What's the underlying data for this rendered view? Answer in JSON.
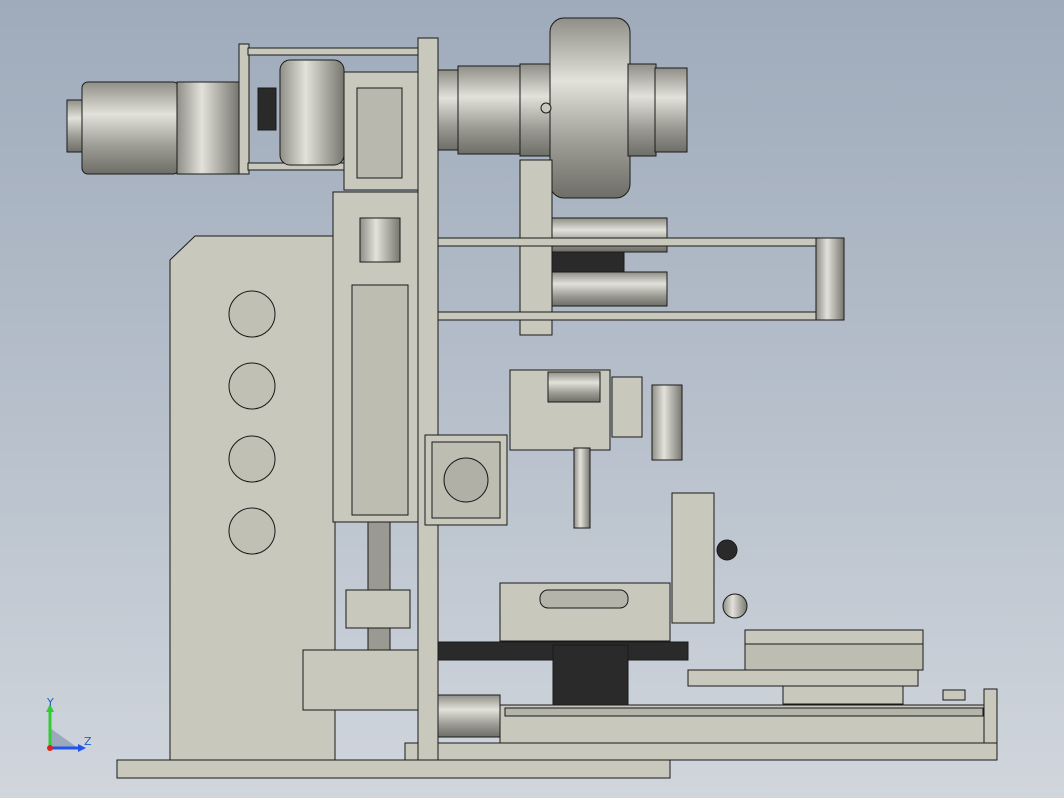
{
  "viewport": {
    "background_top": "#9fabbb",
    "background_bottom": "#d1d6dd",
    "part_fill": "#c8c8bc",
    "part_fill_dark": "#a9a9a0",
    "edge_color": "#1a1a1a",
    "black_part": "#2a2a2a"
  },
  "triad": {
    "y_label": "Y",
    "z_label": "Z",
    "y_color": "#33cc33",
    "z_color": "#2255ee",
    "x_color": "#dd2222"
  }
}
